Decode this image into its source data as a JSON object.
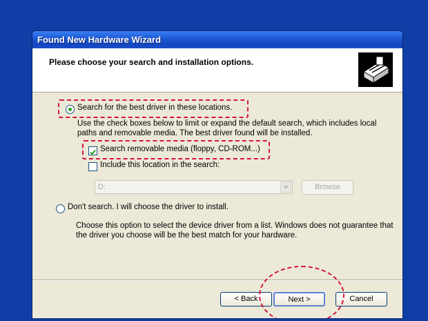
{
  "window": {
    "title": "Found New Hardware Wizard",
    "header_title": "Please choose your search and installation options."
  },
  "options": {
    "search_radio_label": "Search for the best driver in these locations.",
    "search_description": "Use the check boxes below to limit or expand the default search, which includes local paths and removable media. The best driver found will be installed.",
    "removable_media_label": "Search removable media (floppy, CD-ROM...)",
    "include_location_label": "Include this location in the search:",
    "location_value": "D:",
    "browse_label": "Browse",
    "dont_search_label": "Don't search. I will choose the driver to install.",
    "dont_search_description": "Choose this option to select the device driver from a list.  Windows does not guarantee that the driver you choose will be the best match for your hardware."
  },
  "buttons": {
    "back_label": "< Back",
    "next_label": "Next >",
    "cancel_label": "Cancel"
  },
  "state": {
    "search_radio_selected": true,
    "removable_media_checked": true,
    "include_location_checked": false
  },
  "colors": {
    "desktop_blue": "#0f3fa6",
    "annotation_red": "#d4143a",
    "dialog_bg": "#ece9d8"
  }
}
